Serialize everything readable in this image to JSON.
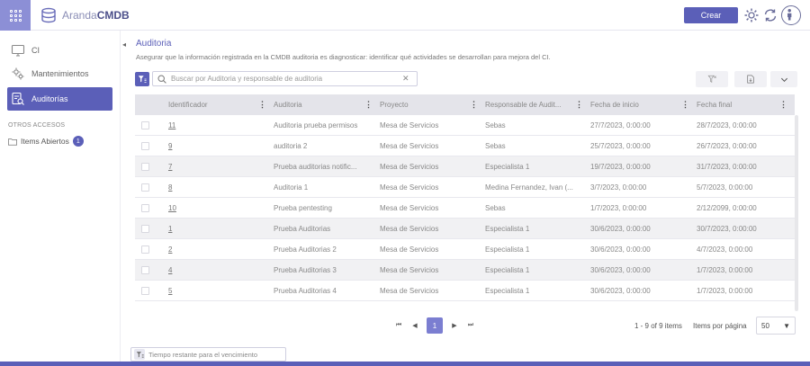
{
  "header": {
    "logo_name": "Aranda",
    "logo_product": "CMDB",
    "create_button": "Crear",
    "accent": "#5b5fb8"
  },
  "sidebar": {
    "items": [
      {
        "label": "CI",
        "icon": "monitor-icon"
      },
      {
        "label": "Mantenimientos",
        "icon": "gears-icon"
      },
      {
        "label": "Auditorías",
        "icon": "audit-icon",
        "active": true
      }
    ],
    "section_title": "OTROS ACCESOS",
    "open_items_label": "Items Abiertos",
    "open_items_count": "1"
  },
  "main": {
    "title": "Auditoria",
    "description": "Asegurar que la información registrada en la CMDB auditoria es diagnosticar: identificar qué actividades se desarrollan para mejora del CI.",
    "search_placeholder": "Buscar por Auditoria y responsable de auditoria",
    "search_value": ""
  },
  "table": {
    "columns": [
      "Identificador",
      "Auditoria",
      "Proyecto",
      "Responsable de Audit...",
      "Fecha de inicio",
      "Fecha final"
    ],
    "rows": [
      {
        "id": "11",
        "auditoria": "Auditoria prueba permisos",
        "proyecto": "Mesa de Servicios",
        "responsable": "Sebas",
        "inicio": "27/7/2023, 0:00:00",
        "final": "28/7/2023, 0:00:00"
      },
      {
        "id": "9",
        "auditoria": "auditoria 2",
        "proyecto": "Mesa de Servicios",
        "responsable": "Sebas",
        "inicio": "25/7/2023, 0:00:00",
        "final": "26/7/2023, 0:00:00"
      },
      {
        "id": "7",
        "auditoria": "Prueba auditorias notific...",
        "proyecto": "Mesa de Servicios",
        "responsable": "Especialista 1",
        "inicio": "19/7/2023, 0:00:00",
        "final": "31/7/2023, 0:00:00"
      },
      {
        "id": "8",
        "auditoria": "Auditoria 1",
        "proyecto": "Mesa de Servicios",
        "responsable": "Medina Fernandez, Ivan (...",
        "inicio": "3/7/2023, 0:00:00",
        "final": "5/7/2023, 0:00:00"
      },
      {
        "id": "10",
        "auditoria": "Prueba pentesting",
        "proyecto": "Mesa de Servicios",
        "responsable": "Sebas",
        "inicio": "1/7/2023, 0:00:00",
        "final": "2/12/2099, 0:00:00"
      },
      {
        "id": "1",
        "auditoria": "Prueba Auditorias",
        "proyecto": "Mesa de Servicios",
        "responsable": "Especialista 1",
        "inicio": "30/6/2023, 0:00:00",
        "final": "30/7/2023, 0:00:00"
      },
      {
        "id": "2",
        "auditoria": "Prueba Auditorias 2",
        "proyecto": "Mesa de Servicios",
        "responsable": "Especialista 1",
        "inicio": "30/6/2023, 0:00:00",
        "final": "4/7/2023, 0:00:00"
      },
      {
        "id": "4",
        "auditoria": "Prueba Auditorias 3",
        "proyecto": "Mesa de Servicios",
        "responsable": "Especialista 1",
        "inicio": "30/6/2023, 0:00:00",
        "final": "1/7/2023, 0:00:00"
      },
      {
        "id": "5",
        "auditoria": "Prueba Auditorias 4",
        "proyecto": "Mesa de Servicios",
        "responsable": "Especialista 1",
        "inicio": "30/6/2023, 0:00:00",
        "final": "1/7/2023, 0:00:00"
      }
    ]
  },
  "pagination": {
    "current_page": "1",
    "range_text": "1 - 9 of 9 items",
    "items_per_page_label": "Items por página",
    "items_per_page": "50"
  },
  "footer": {
    "time_filter_placeholder": "Tiempo restante para el vencimiento"
  }
}
